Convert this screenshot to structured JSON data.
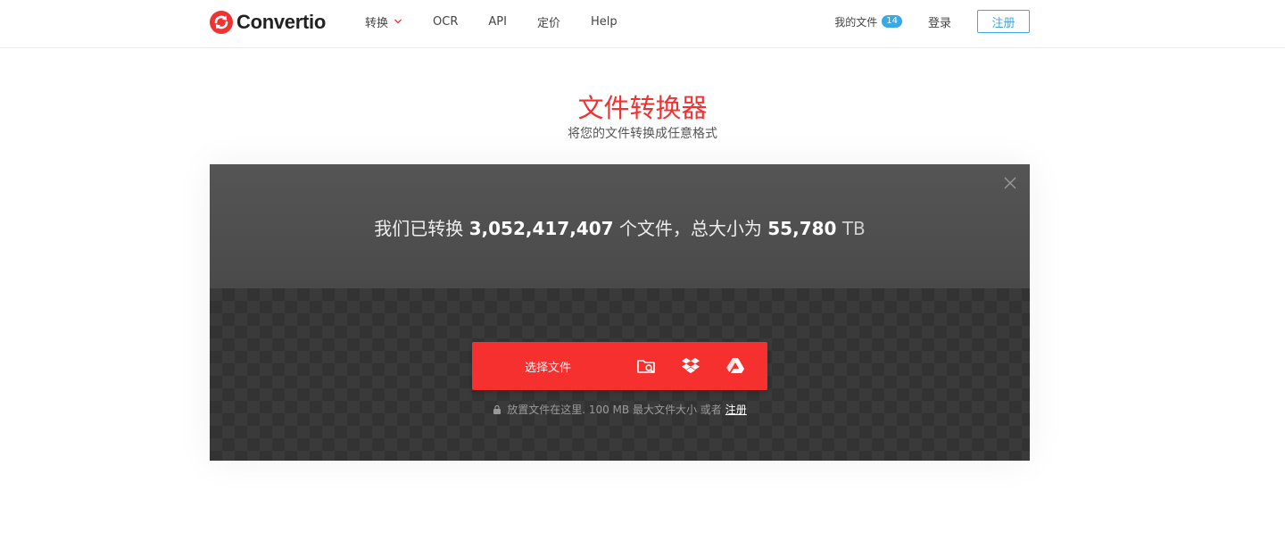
{
  "header": {
    "logo_text": "Convertio",
    "nav": [
      {
        "label": "转换",
        "has_dropdown": true
      },
      {
        "label": "OCR"
      },
      {
        "label": "API"
      },
      {
        "label": "定价"
      },
      {
        "label": "Help"
      }
    ],
    "my_files_label": "我的文件",
    "my_files_count": "14",
    "login_label": "登录",
    "register_label": "注册"
  },
  "hero": {
    "title": "文件转换器",
    "subtitle": "将您的文件转换成任意格式"
  },
  "stats": {
    "prefix": "我们已转换",
    "files_count": "3,052,417,407",
    "middle": "个文件，总大小为",
    "total_size": "55,780",
    "unit": "TB"
  },
  "upload": {
    "choose_label": "选择文件",
    "sources": [
      "folder-search-icon",
      "dropbox-icon",
      "google-drive-icon"
    ],
    "note_text": "放置文件在这里. 100 MB 最大文件大小 或者",
    "note_link": "注册"
  },
  "colors": {
    "brand_red": "#ef3232",
    "upload_red": "#f5302f",
    "accent_blue": "#3ca8e0",
    "panel_dark": "#363636"
  }
}
